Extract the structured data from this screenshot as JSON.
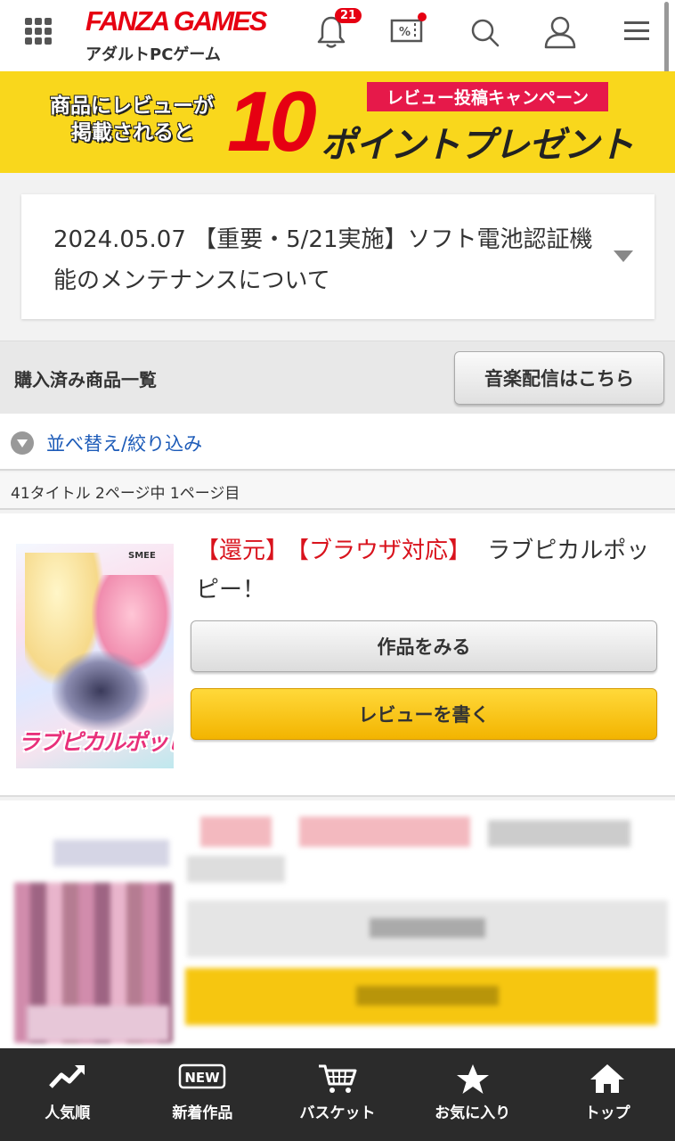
{
  "header": {
    "logo": "FANZA GAMES",
    "subtitle": "アダルトPCゲーム",
    "notification_count": "21"
  },
  "banner": {
    "left_text_1": "商品にレビューが",
    "left_text_2": "掲載されると",
    "number": "10",
    "ribbon": "レビュー投稿キャンペーン",
    "main": "ポイントプレゼント"
  },
  "notice": {
    "text": "2024.05.07 【重要・5/21実施】ソフト電池認証機能のメンテナンスについて"
  },
  "purchased": {
    "title": "購入済み商品一覧",
    "music_button": "音楽配信はこちら"
  },
  "sort": {
    "label": "並べ替え/絞り込み"
  },
  "count": {
    "text": "41タイトル 2ページ中 1ページ目"
  },
  "product": {
    "tag1": "【還元】",
    "tag2": "【ブラウザ対応】",
    "title": "ラブピカルポッピー！",
    "thumb_logo": "ラブピカルポッピー",
    "thumb_brand": "SMEE",
    "view_button": "作品をみる",
    "review_button": "レビューを書く"
  },
  "bottom_nav": {
    "items": [
      {
        "label": "人気順",
        "icon": "trending-icon"
      },
      {
        "label": "新着作品",
        "icon": "new-badge-icon"
      },
      {
        "label": "バスケット",
        "icon": "cart-icon"
      },
      {
        "label": "お気に入り",
        "icon": "star-icon"
      },
      {
        "label": "トップ",
        "icon": "home-icon"
      }
    ]
  },
  "colors": {
    "brand_red": "#e60012",
    "banner_yellow": "#f9d71c",
    "link_blue": "#1d5bb8",
    "review_button": "#f3b400",
    "nav_bg": "#2b2b2b"
  }
}
